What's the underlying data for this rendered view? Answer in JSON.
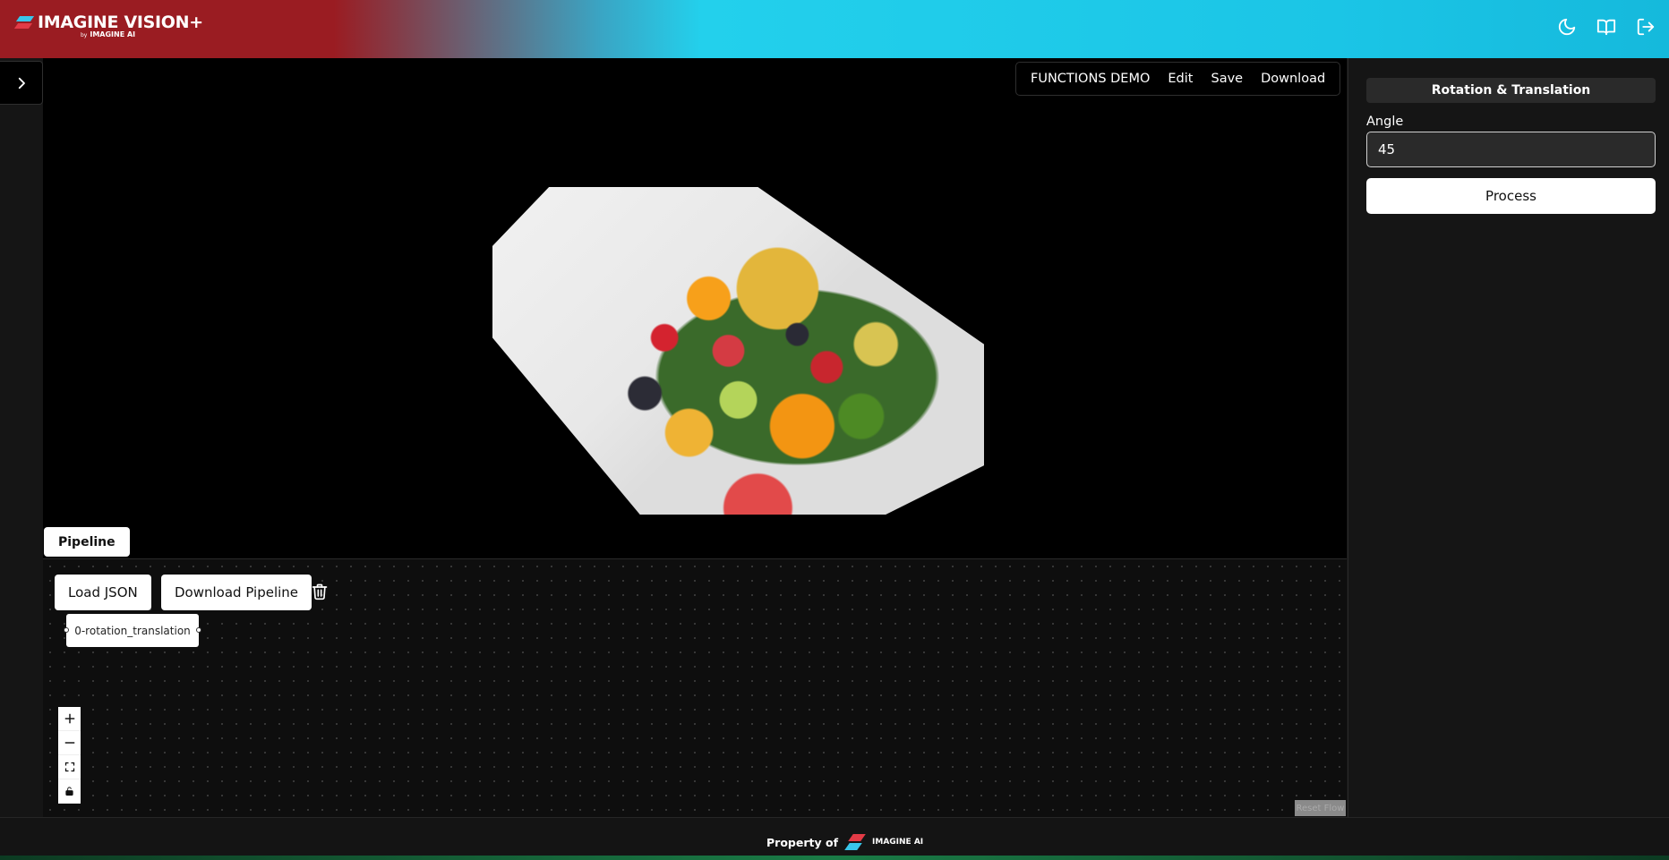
{
  "header": {
    "logo_text": "IMAGINE VISION+",
    "logo_by": "by",
    "logo_sub": "IMAGINE AI",
    "icons": [
      "moon-icon",
      "book-icon",
      "logout-icon"
    ]
  },
  "menubar": {
    "items": [
      "FUNCTIONS DEMO",
      "Edit",
      "Save",
      "Download"
    ]
  },
  "panel": {
    "title": "Rotation & Translation",
    "angle_label": "Angle",
    "angle_value": "45",
    "process_label": "Process"
  },
  "pipeline": {
    "tab_label": "Pipeline",
    "load_json_label": "Load JSON",
    "download_pipeline_label": "Download Pipeline",
    "node_label": "0-rotation_translation",
    "reset_label": "Reset Flow",
    "controls": [
      "plus-icon",
      "minus-icon",
      "fit-view-icon",
      "lock-icon"
    ]
  },
  "footer": {
    "property_text": "Property of",
    "logo_text": "IMAGINE AI"
  },
  "colors": {
    "header_red": "#9a1c22",
    "header_cyan": "#23d0ec",
    "canvas_bg": "#000000",
    "panel_bg": "#151515"
  }
}
